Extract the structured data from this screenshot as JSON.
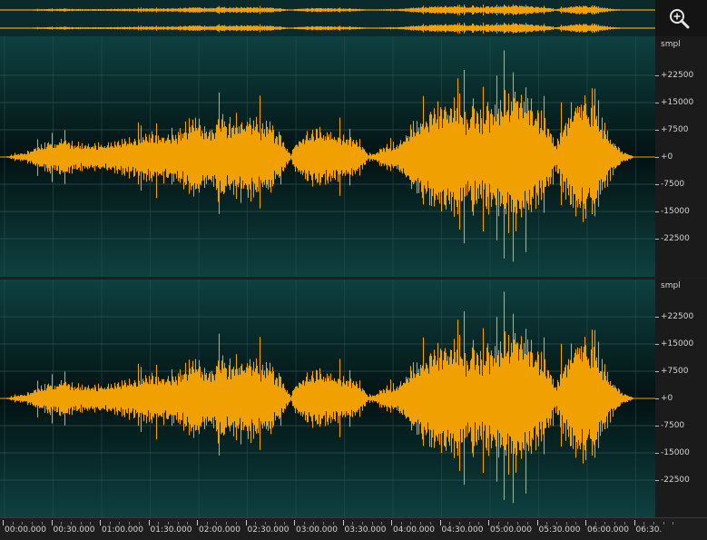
{
  "zoom_button": {
    "icon": "zoom-in-icon"
  },
  "channels": [
    {
      "id": "left",
      "unit_label": "smpl",
      "scale_labels": [
        "+22500",
        "+15000",
        "+7500",
        "+0",
        "-7500",
        "-15000",
        "-22500"
      ],
      "scale_values": [
        22500,
        15000,
        7500,
        0,
        -7500,
        -15000,
        -22500
      ]
    },
    {
      "id": "right",
      "unit_label": "smpl",
      "scale_labels": [
        "+22500",
        "+15000",
        "+7500",
        "+0",
        "-7500",
        "-15000",
        "-22500"
      ],
      "scale_values": [
        22500,
        15000,
        7500,
        0,
        -7500,
        -15000,
        -22500
      ]
    }
  ],
  "timeline": {
    "labels": [
      "00:00.000",
      "00:30.000",
      "01:00.000",
      "01:30.000",
      "02:00.000",
      "02:30.000",
      "03:00.000",
      "03:30.000",
      "04:00.000",
      "04:30.000",
      "05:00.000",
      "05:30.000",
      "06:00.000",
      "06:30."
    ]
  },
  "colors": {
    "waveform": "#f0a000",
    "background": "#0b2a2b",
    "grid": "#2f5555"
  }
}
